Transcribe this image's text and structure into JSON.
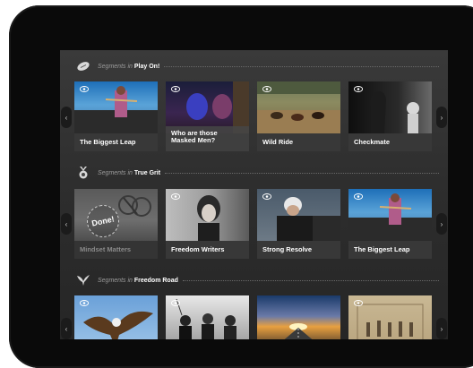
{
  "sections": [
    {
      "prefix": "Segments in",
      "name": "Play On!",
      "icon": "football-icon",
      "cards": [
        {
          "title": "The Biggest Leap",
          "icon": "eye-icon"
        },
        {
          "title": "Who are those Masked Men?",
          "icon": "eye-icon"
        },
        {
          "title": "Wild Ride",
          "icon": "eye-icon"
        },
        {
          "title": "Checkmate",
          "icon": "eye-icon"
        }
      ]
    },
    {
      "prefix": "Segments in",
      "name": "True Grit",
      "icon": "medal-icon",
      "cards": [
        {
          "title": "Mindset Matters",
          "badge": "Done!"
        },
        {
          "title": "Freedom Writers",
          "icon": "eye-icon"
        },
        {
          "title": "Strong Resolve",
          "icon": "eye-icon"
        },
        {
          "title": "The Biggest Leap",
          "icon": "eye-icon"
        }
      ]
    },
    {
      "prefix": "Segments in",
      "name": "Freedom Road",
      "icon": "bird-icon",
      "cards": [
        {
          "title": "",
          "icon": "eye-icon"
        },
        {
          "title": "",
          "icon": "eye-icon"
        },
        {
          "title": "",
          "icon": ""
        },
        {
          "title": "",
          "icon": "eye-icon"
        }
      ]
    }
  ],
  "nav": {
    "left": "‹",
    "right": "›"
  },
  "colors": {
    "background": "#2d2d2d",
    "caption": "#3c3c3c",
    "text": "#ffffff"
  }
}
